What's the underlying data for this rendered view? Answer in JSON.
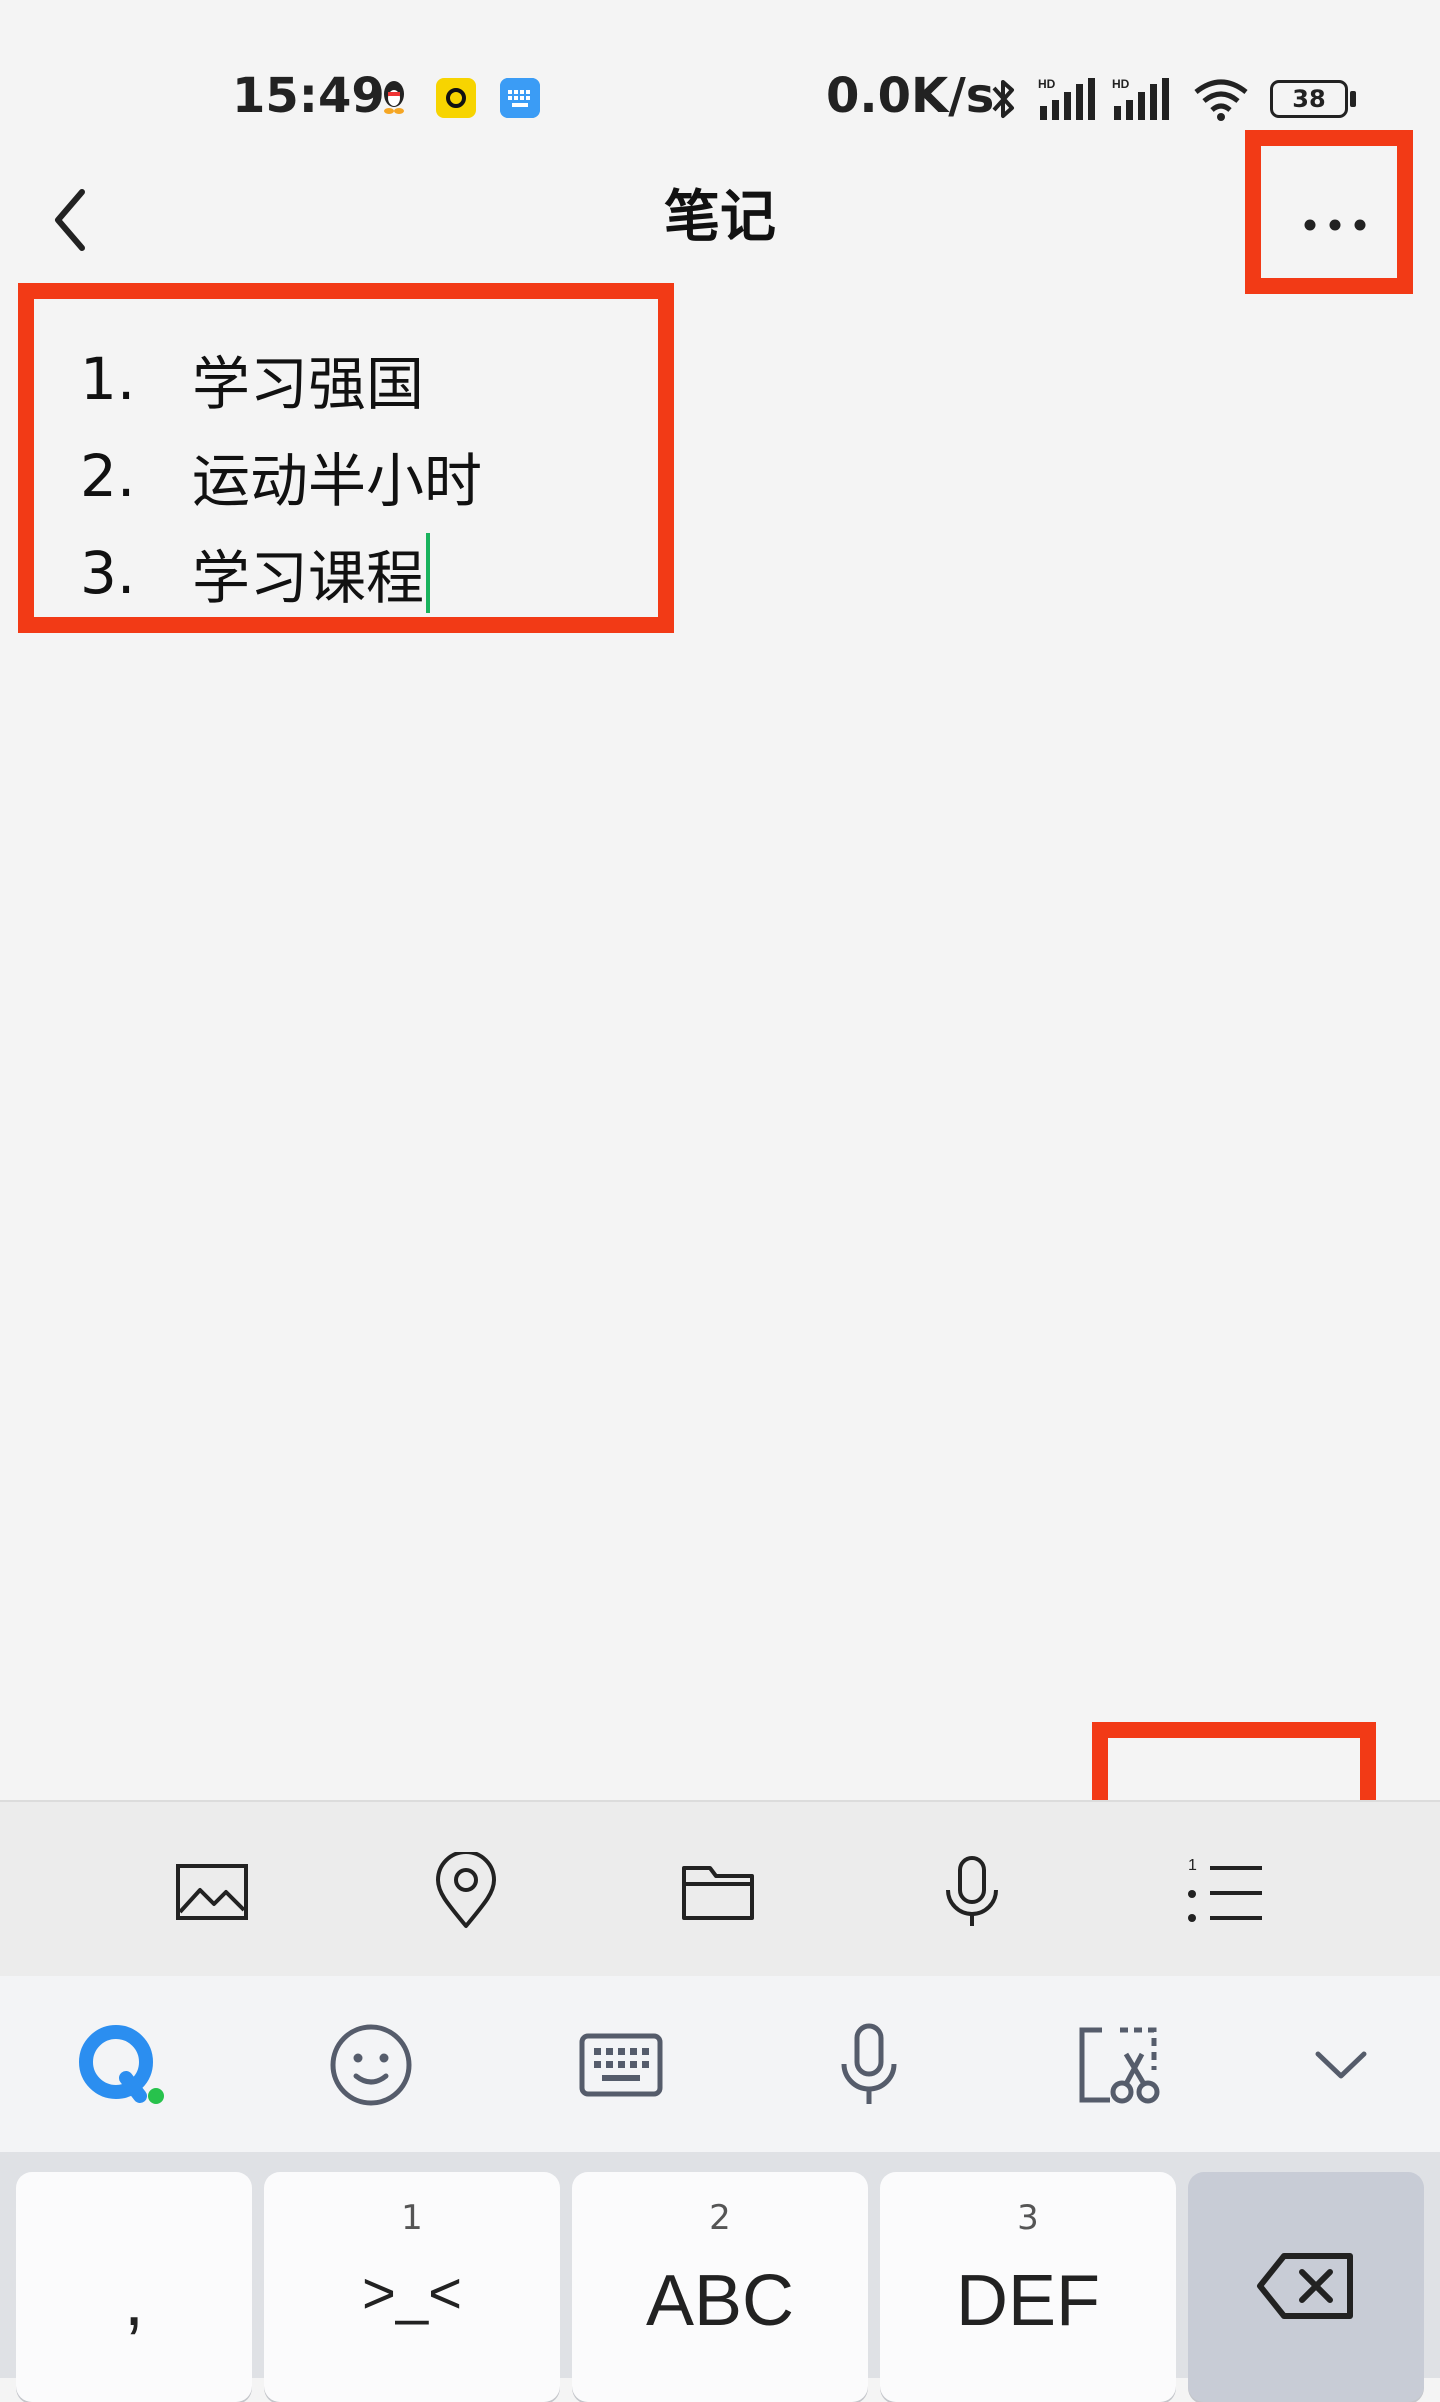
{
  "status_bar": {
    "time": "15:49",
    "net_speed": "0.0K/s",
    "battery": "38"
  },
  "header": {
    "title": "笔记"
  },
  "note": {
    "items": [
      {
        "number": "1.",
        "text": "学习强国"
      },
      {
        "number": "2.",
        "text": "运动半小时"
      },
      {
        "number": "3.",
        "text": "学习课程"
      }
    ]
  },
  "editor_toolbar": {
    "icons": [
      "image-icon",
      "location-pin-icon",
      "folder-icon",
      "microphone-icon",
      "numbered-list-icon"
    ]
  },
  "keyboard": {
    "toolbar_icons": [
      "input-method-logo-icon",
      "emoji-icon",
      "keyboard-icon",
      "voice-input-icon",
      "clipboard-scissors-icon",
      "collapse-keyboard-icon"
    ],
    "keys": [
      {
        "sup": "",
        "label": ","
      },
      {
        "sup": "1",
        "label": ">_<"
      },
      {
        "sup": "2",
        "label": "ABC"
      },
      {
        "sup": "3",
        "label": "DEF"
      }
    ]
  },
  "colors": {
    "annotation": "#f23a16",
    "caret": "#19b35d",
    "brand_blue": "#2b8ef0",
    "brand_green": "#27c24c"
  }
}
